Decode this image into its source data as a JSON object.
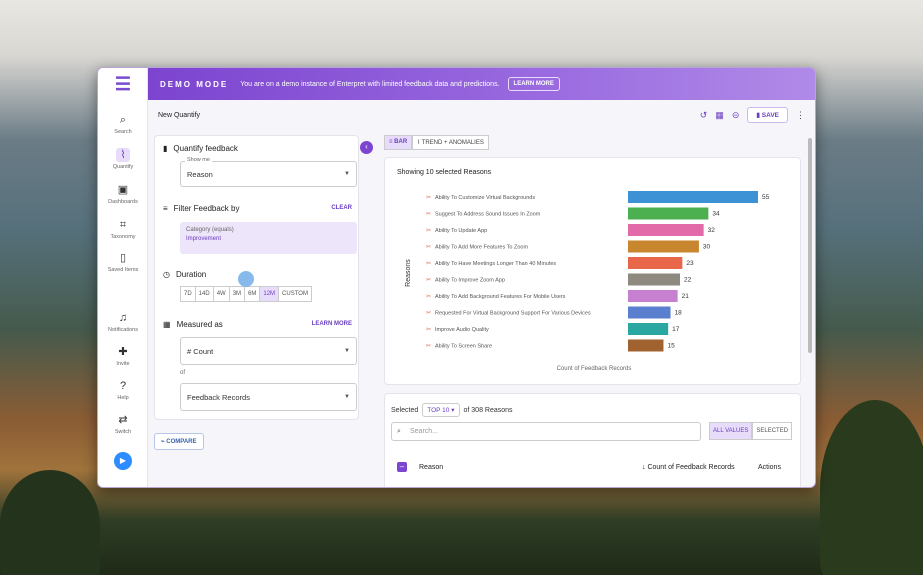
{
  "banner": {
    "mode": "DEMO MODE",
    "message": "You are on a demo instance of Enterpret with limited feedback data and predictions.",
    "learn_more": "LEARN MORE"
  },
  "nav": [
    {
      "label": "Search",
      "icon": "search-icon"
    },
    {
      "label": "Quantify",
      "icon": "quantify-icon",
      "active": true
    },
    {
      "label": "Dashboards",
      "icon": "dashboard-icon"
    },
    {
      "label": "Taxonomy",
      "icon": "taxonomy-icon"
    },
    {
      "label": "Saved Items",
      "icon": "bookmark-icon"
    },
    {
      "label": "Notifications",
      "icon": "bell-icon"
    },
    {
      "label": "Invite",
      "icon": "invite-icon"
    },
    {
      "label": "Help",
      "icon": "help-icon"
    },
    {
      "label": "Switch",
      "icon": "switch-icon"
    }
  ],
  "page": {
    "title": "New Quantify",
    "save": "SAVE"
  },
  "left": {
    "quantify_title": "Quantify feedback",
    "show_me_label": "Show me",
    "show_me_value": "Reason",
    "filter_title": "Filter Feedback by",
    "clear": "CLEAR",
    "filter_category": "Category",
    "filter_op": "(equals)",
    "filter_value": "Improvement",
    "duration_title": "Duration",
    "durations": [
      "7D",
      "14D",
      "4W",
      "3M",
      "6M",
      "12M",
      "CUSTOM"
    ],
    "duration_selected": "12M",
    "measured_title": "Measured as",
    "learn_more": "LEARN MORE",
    "measure_value": "# Count",
    "of_label": "of",
    "records_value": "Feedback Records",
    "compare": "COMPARE"
  },
  "tabs": {
    "bar": "BAR",
    "trend": "TREND + ANOMALIES"
  },
  "chart_data": {
    "type": "bar",
    "title": "Showing 10 selected Reasons",
    "ylabel": "Reasons",
    "xlabel": "Count of Feedback Records",
    "categories": [
      "Ability To Customize Virtual Backgrounds",
      "Suggest To Address Sound Issues In Zoom",
      "Ability To Update App",
      "Ability To Add More Features To Zoom",
      "Ability To Have Meetings Longer Than 40 Minutes",
      "Ability To Improve Zoom App",
      "Ability To Add Background Features For Mobile Users",
      "Requested For Virtual Background Support For Various Devices",
      "Improve Audio Quality",
      "Ability To Screen Share"
    ],
    "values": [
      55,
      34,
      32,
      30,
      23,
      22,
      21,
      18,
      17,
      15
    ],
    "colors": [
      "#3d92d6",
      "#4caf50",
      "#e26aa8",
      "#c8862e",
      "#e8674a",
      "#8f8a80",
      "#c77fd0",
      "#5b7fcf",
      "#2aa7a1",
      "#a0622e"
    ],
    "xlim": [
      0,
      55
    ]
  },
  "table": {
    "selected_label": "Selected",
    "top": "TOP 10",
    "of_text": "of 308 Reasons",
    "search_placeholder": "Search...",
    "all_values": "ALL VALUES",
    "selected_toggle": "SELECTED",
    "col_reason": "Reason",
    "col_count": "Count of Feedback Records",
    "col_actions": "Actions"
  }
}
